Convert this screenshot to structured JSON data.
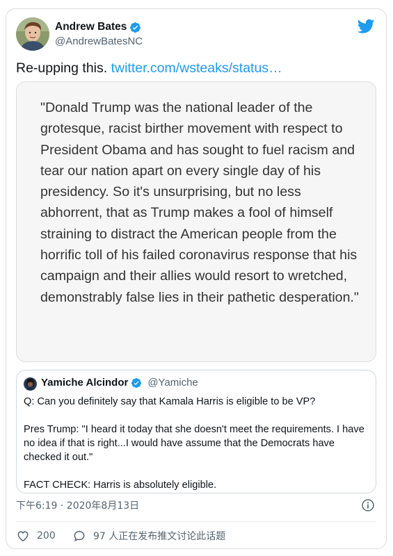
{
  "author": {
    "name": "Andrew Bates",
    "handle": "@AndrewBatesNC"
  },
  "tweet": {
    "text": "Re-upping this. ",
    "link": "twitter.com/wsteaks/status…"
  },
  "media": {
    "quote_text": "\"Donald Trump was the national leader of the grotesque, racist birther movement with respect to President Obama and has sought to fuel racism and tear our nation apart on every single day of his presidency. So it's unsurprising, but no less abhorrent, that as Trump makes a fool of himself straining to distract the American people from the horrific toll of his failed coronavirus response that his campaign and their allies would resort to wretched, demonstrably false lies in their pathetic desperation.\""
  },
  "quoted_tweet": {
    "name": "Yamiche Alcindor",
    "handle": "@Yamiche",
    "line1": "Q: Can you definitely say that Kamala Harris is eligible to be VP?",
    "line2": "Pres Trump: \"I heard it today that she doesn't meet the requirements. I have no idea if that is right...I would have assume that the Democrats have checked it out.\"",
    "line3": "FACT CHECK: Harris is absolutely eligible."
  },
  "meta": {
    "timestamp": "下午6:19 · 2020年8月13日"
  },
  "actions": {
    "likes": "200",
    "replies": "97 人正在发布推文讨论此话题"
  },
  "icons": {
    "verified": "verified-badge-icon",
    "brand": "twitter-bird-icon",
    "info": "info-icon",
    "like": "heart-icon",
    "reply": "reply-bubble-icon"
  },
  "colors": {
    "accent": "#1d9bf0",
    "text": "#0f1419",
    "secondary": "#536471",
    "media_bg": "#f6f6f6"
  }
}
